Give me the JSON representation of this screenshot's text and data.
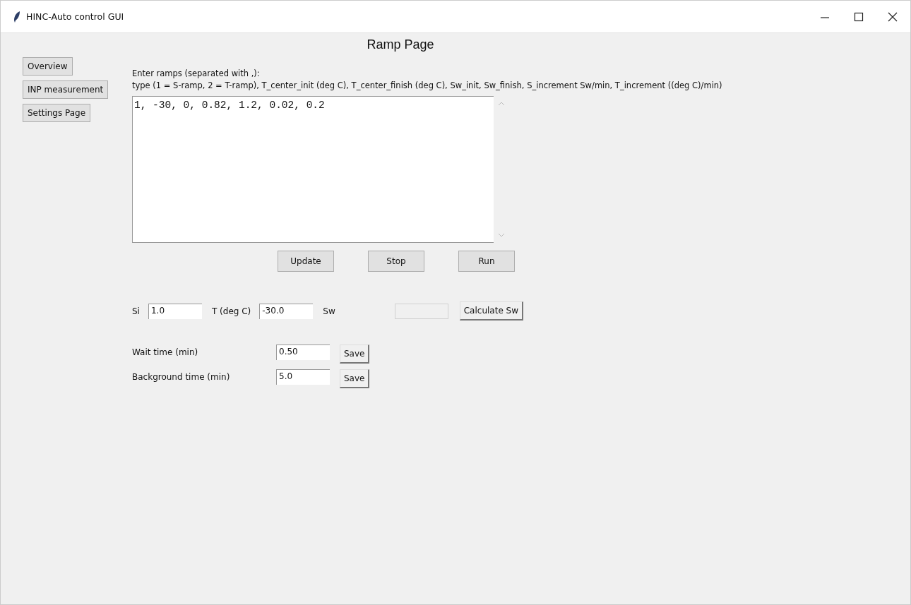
{
  "window": {
    "title": "HINC-Auto control GUI"
  },
  "sidebar": {
    "items": [
      {
        "label": "Overview"
      },
      {
        "label": "INP measurement"
      },
      {
        "label": "Settings Page"
      }
    ]
  },
  "page_title": "Ramp Page",
  "instructions": [
    "Enter ramps (separated with ,):",
    "type (1 = S-ramp, 2 = T-ramp), T_center_init (deg C), T_center_finish (deg C), Sw_init, Sw_finish, S_increment Sw/min, T_increment ((deg C)/min)"
  ],
  "ramps_text": "1, -30, 0, 0.82, 1.2, 0.02, 0.2",
  "ramp_buttons": [
    "Update",
    "Stop",
    "Run"
  ],
  "calc_row": {
    "fields": [
      {
        "label": "Si",
        "value": "1.0",
        "disabled": false
      },
      {
        "label": "T (deg C)",
        "value": "-30.0",
        "disabled": false
      },
      {
        "label": "Sw",
        "disabled": true
      }
    ],
    "button": "Calculate Sw"
  },
  "settings": [
    {
      "label": "Wait time (min)",
      "value": "0.50",
      "button": "Save"
    },
    {
      "label": "Background time (min)",
      "value": "5.0",
      "button": "Save"
    }
  ]
}
